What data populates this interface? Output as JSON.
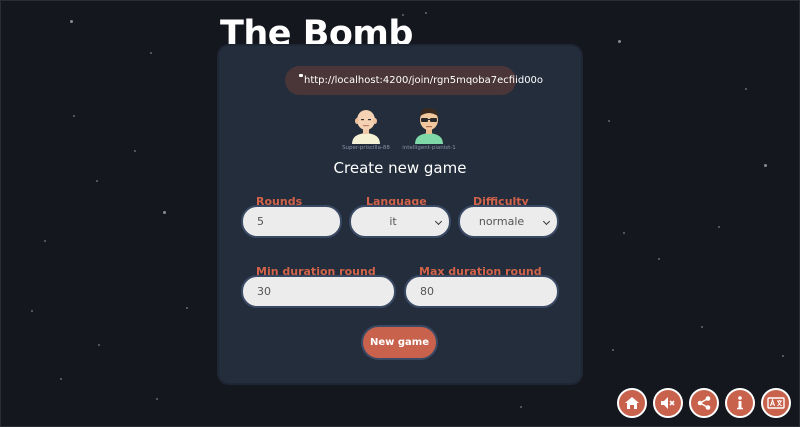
{
  "app": {
    "title": "The Bomb"
  },
  "invite": {
    "url": "http://localhost:4200/join/rgn5mqoba7ecfiid00o"
  },
  "players": [
    {
      "name": "Super-priscilla-88",
      "avatar": "bald-man-avatar"
    },
    {
      "name": "intelligent-pianist-1",
      "avatar": "sunglasses-man-avatar"
    }
  ],
  "form": {
    "heading": "Create new game",
    "rounds": {
      "label": "Rounds",
      "value": "5"
    },
    "language": {
      "label": "Language",
      "value": "it"
    },
    "difficulty": {
      "label": "Difficulty",
      "value": "normale"
    },
    "min_duration": {
      "label": "Min duration round",
      "value": "30"
    },
    "max_duration": {
      "label": "Max duration round",
      "value": "80"
    },
    "submit_label": "New game"
  },
  "toolbar": {
    "icons": [
      "home-icon",
      "mute-icon",
      "share-icon",
      "info-icon",
      "translate-icon"
    ]
  },
  "colors": {
    "background": "#14171d",
    "card": "#232d3c",
    "accent": "#c8624d",
    "label": "#d2634a",
    "link_pill": "#4a3638"
  }
}
